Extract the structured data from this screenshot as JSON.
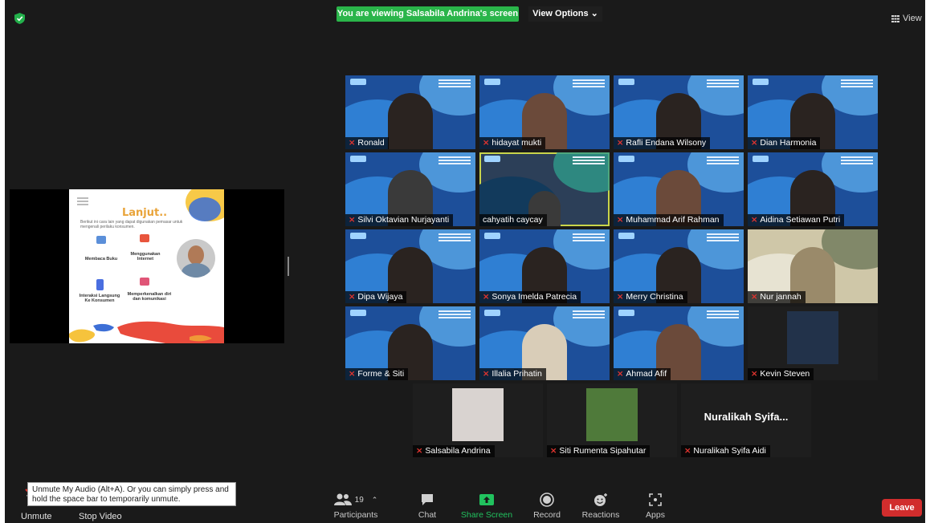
{
  "topbar": {
    "banner": "You are viewing Salsabila Andrina's screen",
    "view_options": "View Options ⌄",
    "view_label": "View"
  },
  "shared_slide": {
    "title": "Lanjut..",
    "subtitle": "Berikut ini cara lain yang dapat digunakan pemasar untuk mengenali perilaku konsumen.",
    "items": [
      "Membaca Buku",
      "Menggunakan Internet",
      "Interaksi Langsung Ke Konsumen",
      "Memperkenalkan diri dan komunikasi"
    ]
  },
  "participants": [
    {
      "name": "Ronald",
      "muted": true
    },
    {
      "name": "hidayat mukti",
      "muted": true
    },
    {
      "name": "Rafli Endana Wilsony",
      "muted": true
    },
    {
      "name": "Dian Harmonia",
      "muted": true
    },
    {
      "name": "Silvi Oktavian Nurjayanti",
      "muted": true
    },
    {
      "name": "cahyatih caycay",
      "muted": false
    },
    {
      "name": "Muhammad Arif Rahman",
      "muted": true
    },
    {
      "name": "Aidina Setiawan Putri",
      "muted": true
    },
    {
      "name": "Dipa Wijaya",
      "muted": true
    },
    {
      "name": "Sonya Imelda Patrecia",
      "muted": true
    },
    {
      "name": "Merry Christina",
      "muted": true
    },
    {
      "name": "Nur jannah",
      "muted": true
    },
    {
      "name": "Forme & Siti",
      "muted": true
    },
    {
      "name": "Illalia Prihatin",
      "muted": true
    },
    {
      "name": "Ahmad Afif",
      "muted": true
    },
    {
      "name": "Kevin Steven",
      "muted": true
    },
    {
      "name": "Salsabila Andrina",
      "muted": true
    },
    {
      "name": "Siti Rumenta Sipahutar",
      "muted": true
    },
    {
      "name": "Nuralikah Syifa Aidi",
      "muted": true,
      "display_text": "Nuralikah  Syifa..."
    }
  ],
  "toolbar": {
    "unmute": "Unmute",
    "stop_video": "Stop Video",
    "participants": "Participants",
    "participant_count": "19",
    "chat": "Chat",
    "share_screen": "Share Screen",
    "record": "Record",
    "reactions": "Reactions",
    "apps": "Apps",
    "leave": "Leave"
  },
  "tooltip": "Unmute My Audio (Alt+A). Or you can simply press and hold the space bar to temporarily unmute.",
  "colors": {
    "banner": "#2ab54a",
    "leave": "#d12d2d",
    "share_screen": "#21c25e",
    "mute_icon": "#e0342f",
    "active_speaker": "#c9d44a"
  }
}
